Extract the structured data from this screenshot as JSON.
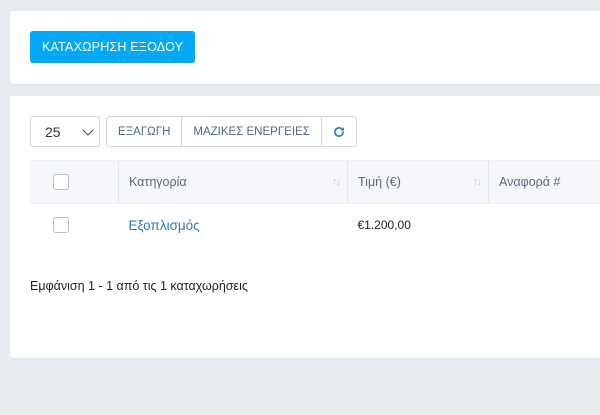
{
  "header": {
    "add_expense_label": "ΚΑΤΑΧΩΡΗΣΗ ΕΞΟΔΟΥ"
  },
  "toolbar": {
    "page_size": "25",
    "export_label": "ΕΞΑΓΩΓΗ",
    "bulk_actions_label": "ΜΑΖΙΚΕΣ ΕΝΕΡΓΕΙΕΣ",
    "refresh_icon": "refresh-icon"
  },
  "table": {
    "columns": [
      "Κατηγορία",
      "Τιμή (€)",
      "Αναφορά #"
    ],
    "rows": [
      {
        "category": "Εξοπλισμός",
        "price": "€1.200,00",
        "reference": ""
      }
    ]
  },
  "footer": {
    "info": "Εμφάνιση 1 - 1 από τις 1 καταχωρήσεις"
  },
  "colors": {
    "primary": "#03a9f4",
    "link": "#2a7ab8",
    "background": "#e8ebf0"
  }
}
